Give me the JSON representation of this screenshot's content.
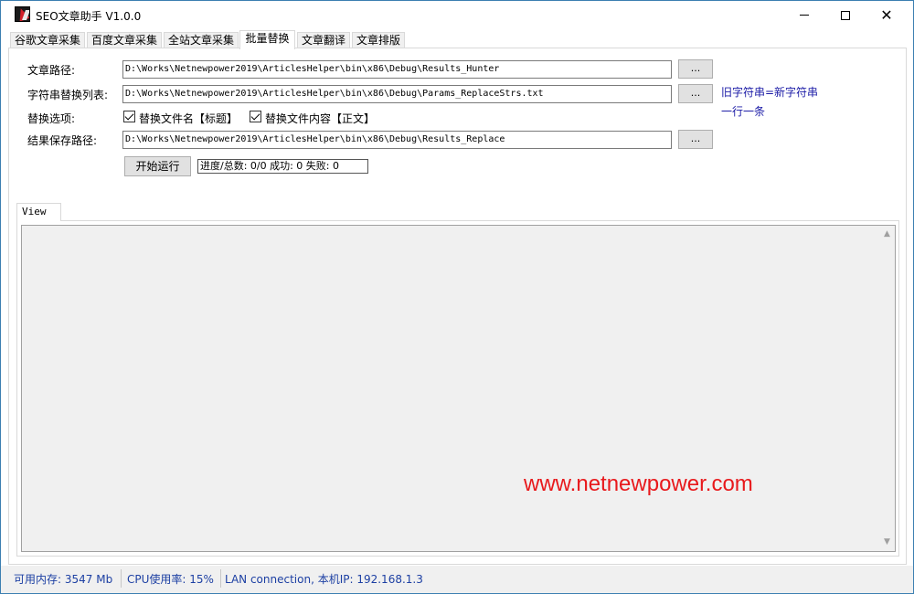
{
  "window": {
    "title": "SEO文章助手 V1.0.0",
    "min_icon": "minimize-icon",
    "max_icon": "maximize-icon",
    "close_icon": "close-icon"
  },
  "tabs": [
    {
      "label": "谷歌文章采集",
      "active": false
    },
    {
      "label": "百度文章采集",
      "active": false
    },
    {
      "label": "全站文章采集",
      "active": false
    },
    {
      "label": "批量替换",
      "active": true
    },
    {
      "label": "文章翻译",
      "active": false
    },
    {
      "label": "文章排版",
      "active": false
    }
  ],
  "form": {
    "article_path_label": "文章路径:",
    "article_path_value": "D:\\Works\\Netnewpower2019\\ArticlesHelper\\bin\\x86\\Debug\\Results_Hunter",
    "replace_list_label": "字符串替换列表:",
    "replace_list_value": "D:\\Works\\Netnewpower2019\\ArticlesHelper\\bin\\x86\\Debug\\Params_ReplaceStrs.txt",
    "options_label": "替换选项:",
    "option_filename_label": "替换文件名【标题】",
    "option_filename_checked": true,
    "option_content_label": "替换文件内容【正文】",
    "option_content_checked": true,
    "save_path_label": "结果保存路径:",
    "save_path_value": "D:\\Works\\Netnewpower2019\\ArticlesHelper\\bin\\x86\\Debug\\Results_Replace",
    "browse_label": "...",
    "hint_line1": "旧字符串=新字符串",
    "hint_line2": "一行一条",
    "start_button": "开始运行",
    "progress_text": "进度/总数: 0/0 成功: 0 失败: 0"
  },
  "view": {
    "tab_label": "View",
    "watermark": "www.netnewpower.com"
  },
  "status": {
    "memory": "可用内存: 3547 Mb",
    "cpu": "CPU使用率: 15%",
    "network": "LAN connection, 本机IP: 192.168.1.3"
  },
  "colors": {
    "hint": "#1a1aa6",
    "watermark": "#e8191c",
    "status_text": "#1c3fa3"
  }
}
